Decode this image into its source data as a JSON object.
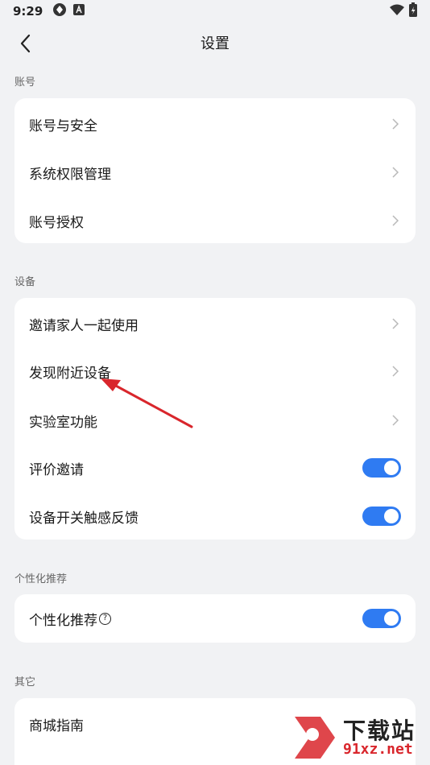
{
  "status_bar": {
    "time": "9:29"
  },
  "header": {
    "title": "设置"
  },
  "sections": [
    {
      "label": "账号",
      "items": [
        {
          "label": "账号与安全",
          "control": "chevron"
        },
        {
          "label": "系统权限管理",
          "control": "chevron"
        },
        {
          "label": "账号授权",
          "control": "chevron"
        }
      ]
    },
    {
      "label": "设备",
      "items": [
        {
          "label": "邀请家人一起使用",
          "control": "chevron"
        },
        {
          "label": "发现附近设备",
          "control": "chevron"
        },
        {
          "label": "实验室功能",
          "control": "chevron"
        },
        {
          "label": "评价邀请",
          "control": "toggle",
          "on": true
        },
        {
          "label": "设备开关触感反馈",
          "control": "toggle",
          "on": true
        }
      ]
    },
    {
      "label": "个性化推荐",
      "items": [
        {
          "label": "个性化推荐",
          "control": "toggle",
          "on": true,
          "help_icon": "question-circle-icon"
        }
      ]
    },
    {
      "label": "其它",
      "items": [
        {
          "label": "商城指南",
          "control": "none"
        }
      ]
    }
  ],
  "watermark": {
    "brand": "下载站",
    "domain": "91xz.net"
  },
  "colors": {
    "accent": "#2f7bf2",
    "annotation_arrow": "#d9262c"
  }
}
